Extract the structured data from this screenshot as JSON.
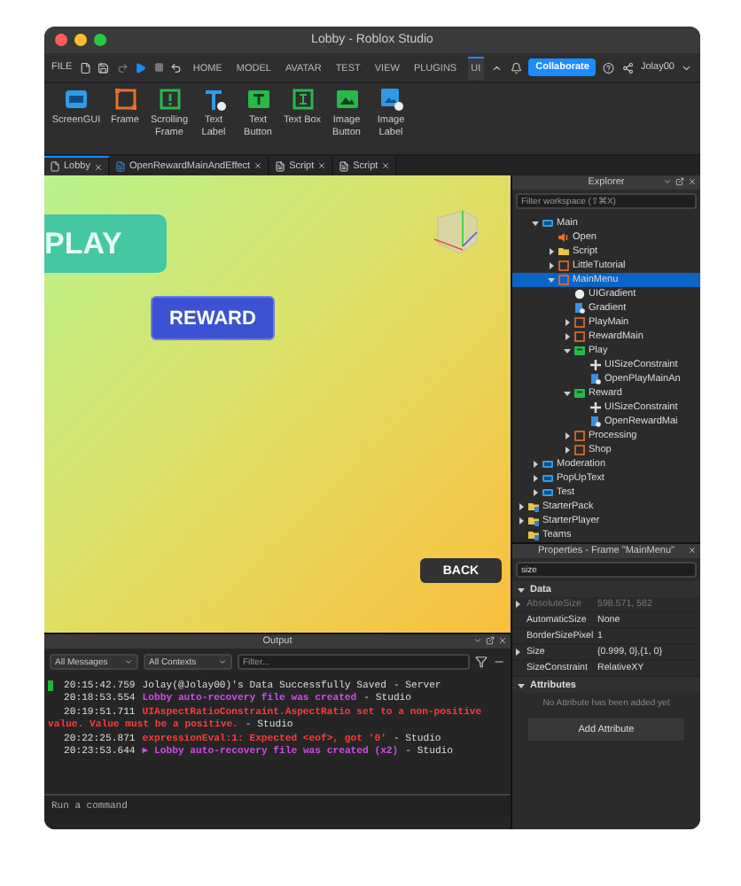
{
  "window": {
    "title": "Lobby - Roblox Studio"
  },
  "menu": {
    "file": "FILE",
    "tabs": [
      {
        "label": "HOME",
        "selected": false
      },
      {
        "label": "MODEL",
        "selected": false
      },
      {
        "label": "AVATAR",
        "selected": false
      },
      {
        "label": "TEST",
        "selected": false
      },
      {
        "label": "VIEW",
        "selected": false
      },
      {
        "label": "PLUGINS",
        "selected": false
      },
      {
        "label": "UI",
        "selected": true
      }
    ],
    "collaborate": "Collaborate",
    "user": "Jolay00"
  },
  "ribbon": {
    "tools": [
      {
        "label": "ScreenGUI",
        "kind": "screengui"
      },
      {
        "label": "Frame",
        "kind": "frame"
      },
      {
        "label": "Scrolling Frame",
        "kind": "scrolling"
      },
      {
        "label": "Text Label",
        "kind": "textlabel"
      },
      {
        "label": "Text Button",
        "kind": "textbutton"
      },
      {
        "label": "Text Box",
        "kind": "textbox"
      },
      {
        "label": "Image Button",
        "kind": "imagebutton"
      },
      {
        "label": "Image Label",
        "kind": "imagelabel"
      }
    ]
  },
  "doc_tabs": [
    {
      "label": "Lobby",
      "kind": "place",
      "selected": true
    },
    {
      "label": "OpenRewardMainAndEffect",
      "kind": "localscript",
      "selected": false
    },
    {
      "label": "Script",
      "kind": "script",
      "selected": false
    },
    {
      "label": "Script",
      "kind": "script",
      "selected": false
    }
  ],
  "viewport": {
    "play": "PLAY",
    "reward": "REWARD",
    "back": "BACK"
  },
  "explorer": {
    "title": "Explorer",
    "placeholder": "Filter workspace (⇧⌘X)",
    "tree": [
      {
        "label": "Main",
        "kind": "screengui",
        "expanded": true,
        "selected": false,
        "children": [
          {
            "label": "Open",
            "kind": "sound",
            "selected": false
          },
          {
            "label": "Script",
            "kind": "folder",
            "expanded": false,
            "selected": false
          },
          {
            "label": "LittleTutorial",
            "kind": "frame",
            "expanded": false,
            "selected": false
          },
          {
            "label": "MainMenu",
            "kind": "frame",
            "expanded": true,
            "selected": true,
            "children": [
              {
                "label": "UIGradient",
                "kind": "gradient",
                "selected": false
              },
              {
                "label": "Gradient",
                "kind": "localscript",
                "selected": false
              },
              {
                "label": "PlayMain",
                "kind": "frame",
                "expanded": false,
                "selected": false
              },
              {
                "label": "RewardMain",
                "kind": "frame",
                "expanded": false,
                "selected": false
              },
              {
                "label": "Play",
                "kind": "button",
                "expanded": true,
                "selected": false,
                "children": [
                  {
                    "label": "UISizeConstraint",
                    "kind": "constraint",
                    "selected": false
                  },
                  {
                    "label": "OpenPlayMainAn",
                    "kind": "localscript",
                    "selected": false
                  }
                ]
              },
              {
                "label": "Reward",
                "kind": "button",
                "expanded": true,
                "selected": false,
                "children": [
                  {
                    "label": "UISizeConstraint",
                    "kind": "constraint",
                    "selected": false
                  },
                  {
                    "label": "OpenRewardMai",
                    "kind": "localscript",
                    "selected": false
                  }
                ]
              },
              {
                "label": "Processing",
                "kind": "frame",
                "expanded": false,
                "selected": false
              },
              {
                "label": "Shop",
                "kind": "frame",
                "expanded": false,
                "selected": false
              }
            ]
          }
        ]
      },
      {
        "label": "Moderation",
        "kind": "screengui",
        "expanded": false,
        "selected": false
      },
      {
        "label": "PopUpText",
        "kind": "screengui",
        "expanded": false,
        "selected": false
      },
      {
        "label": "Test",
        "kind": "screengui",
        "expanded": false,
        "selected": false
      },
      {
        "label": "StarterPack",
        "kind": "service",
        "expanded": false,
        "selected": false,
        "outdent": true
      },
      {
        "label": "StarterPlayer",
        "kind": "service",
        "expanded": false,
        "selected": false,
        "outdent": true
      },
      {
        "label": "Teams",
        "kind": "service",
        "selected": false,
        "outdent": true
      }
    ]
  },
  "properties": {
    "title": "Properties - Frame \"MainMenu\"",
    "filter": "size",
    "sections": [
      {
        "title": "Data",
        "expanded": true,
        "rows": [
          {
            "name": "AbsoluteSize",
            "value": "598.571, 582",
            "expandable": true,
            "disabled": true
          },
          {
            "name": "AutomaticSize",
            "value": "None",
            "expandable": false,
            "disabled": false
          },
          {
            "name": "BorderSizePixel",
            "value": "1",
            "expandable": false,
            "disabled": false
          },
          {
            "name": "Size",
            "value": "{0.999, 0},{1, 0}",
            "expandable": true,
            "disabled": false
          },
          {
            "name": "SizeConstraint",
            "value": "RelativeXY",
            "expandable": false,
            "disabled": false
          }
        ]
      },
      {
        "title": "Attributes",
        "expanded": true,
        "empty": "No Attribute has been added yet",
        "button": "Add Attribute"
      }
    ]
  },
  "output": {
    "title": "Output",
    "filters": [
      "All Messages",
      "All Contexts"
    ],
    "placeholder": "Filter...",
    "lines": [
      {
        "time": "20:15:42.759",
        "message": "Jolay(@Jolay00)'s Data Successfully Saved",
        "source": "-  Server",
        "kind": "info",
        "marked": true
      },
      {
        "time": "20:18:53.554",
        "message": "Lobby auto-recovery file was created",
        "source": "-  Studio",
        "kind": "notice",
        "marked": false
      },
      {
        "time": "20:19:51.711",
        "message": "UIAspectRatioConstraint.AspectRatio set to a non-positive value. Value must be a positive.",
        "source": "-  Studio",
        "kind": "error",
        "marked": false
      },
      {
        "time": "20:22:25.871",
        "message": "expressionEval:1: Expected <eof>, got '0'",
        "source": "-  Studio",
        "kind": "error",
        "marked": false
      },
      {
        "time": "20:23:53.644",
        "message": "▶ Lobby auto-recovery file was created (x2)",
        "source": "-  Studio",
        "kind": "notice",
        "marked": false
      }
    ],
    "command_placeholder": "Run a command"
  }
}
